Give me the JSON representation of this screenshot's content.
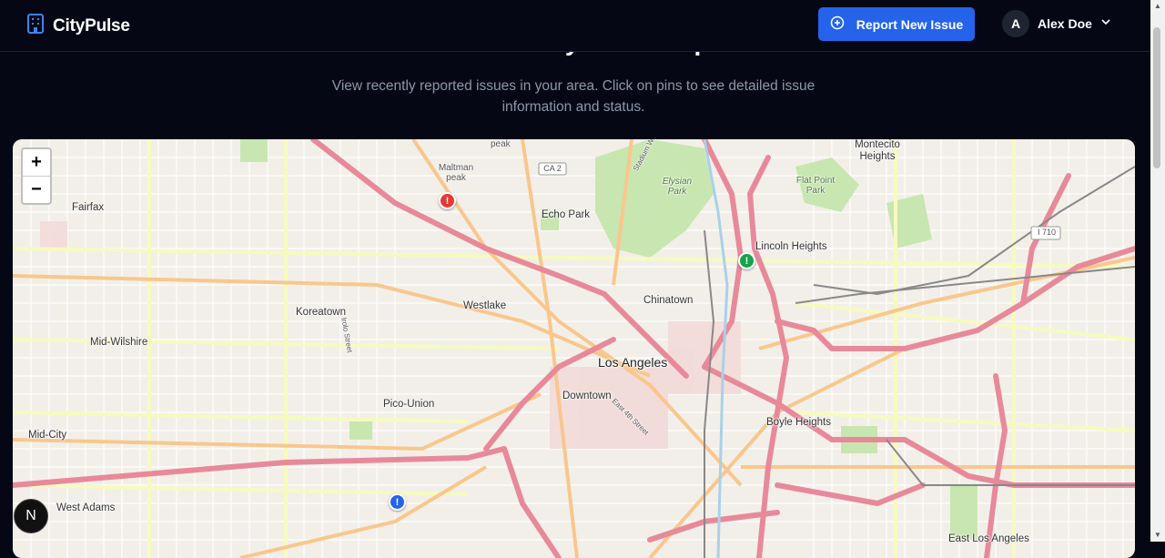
{
  "header": {
    "brand": "CityPulse",
    "report_button": "Report New Issue",
    "user_initial": "A",
    "user_name": "Alex Doe"
  },
  "hero": {
    "title": "Community Issue Map",
    "subtitle": "View recently reported issues in your area. Click on pins to see detailed issue information and status."
  },
  "map": {
    "zoom_in": "+",
    "zoom_out": "−",
    "places": {
      "fairfax": "Fairfax",
      "maltman_peak": "Maltman peak",
      "echo_park": "Echo Park",
      "elysian_park": "Elysian Park",
      "flat_point_park": "Flat Point Park",
      "montecito_heights": "Montecito Heights",
      "lincoln_heights": "Lincoln Heights",
      "koreatown": "Koreatown",
      "westlake": "Westlake",
      "chinatown": "Chinatown",
      "mid_wilshire": "Mid-Wilshire",
      "los_angeles": "Los Angeles",
      "downtown": "Downtown",
      "pico_union": "Pico-Union",
      "boyle_heights": "Boyle Heights",
      "mid_city": "Mid-City",
      "west_adams": "West Adams",
      "east_los_angeles": "East Los Angeles",
      "ca2": "CA 2",
      "i710": "I 710",
      "peak": "peak",
      "stadium_way": "Stadium Way",
      "irolo": "Irolo Street",
      "east_4th": "East 4th Street"
    },
    "pins": [
      {
        "type": "red-alert",
        "symbol": "!",
        "color": "#e53935"
      },
      {
        "type": "green-alert",
        "symbol": "!",
        "color": "#16a34a"
      },
      {
        "type": "blue-alert",
        "symbol": "!",
        "color": "#2563eb"
      }
    ]
  },
  "badge": "N"
}
